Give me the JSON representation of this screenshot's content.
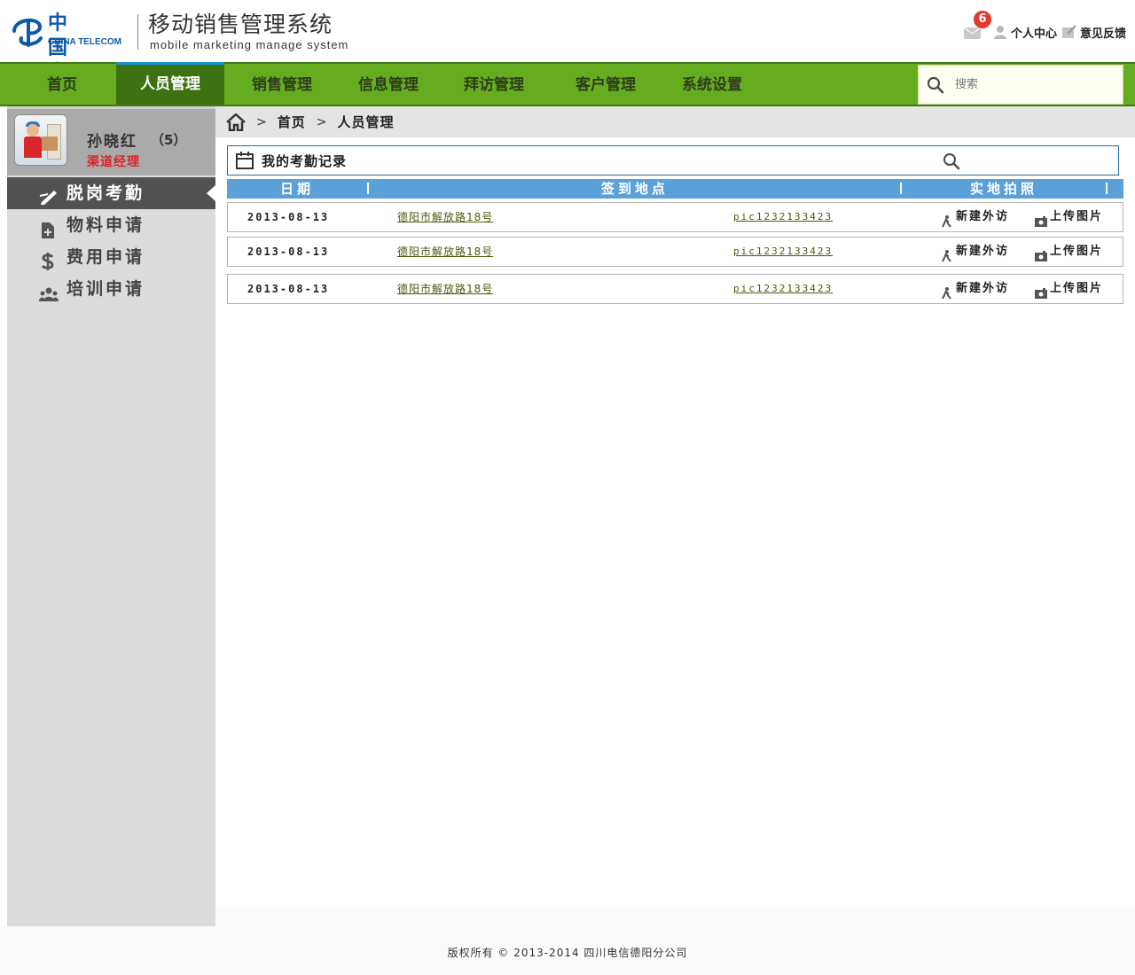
{
  "brand": {
    "logo_cn": "中国电信",
    "logo_en": "CHINA TELECOM",
    "system_title": "移动销售管理系统",
    "system_subtitle": "mobile marketing manage system"
  },
  "topbar": {
    "mail_badge": "6",
    "personal_center": "个人中心",
    "feedback": "意见反馈"
  },
  "nav": {
    "items": [
      {
        "label": "首页"
      },
      {
        "label": "人员管理"
      },
      {
        "label": "销售管理"
      },
      {
        "label": "信息管理"
      },
      {
        "label": "拜访管理"
      },
      {
        "label": "客户管理"
      },
      {
        "label": "系统设置"
      }
    ],
    "active_index": 1,
    "search_placeholder": "搜索"
  },
  "profile": {
    "name": "孙晓红",
    "count": "（5）",
    "role": "渠道经理"
  },
  "sidebar": {
    "items": [
      {
        "label": "脱岗考勤",
        "icon": "edit-icon",
        "active": true
      },
      {
        "label": "物料申请",
        "icon": "file-add-icon",
        "active": false
      },
      {
        "label": "费用申请",
        "icon": "dollar-icon",
        "active": false
      },
      {
        "label": "培训申请",
        "icon": "group-icon",
        "active": false
      }
    ]
  },
  "breadcrumb": {
    "home": "首页",
    "current": "人员管理"
  },
  "panel": {
    "title": "我的考勤记录"
  },
  "table": {
    "headers": [
      "日期",
      "签到地点",
      "实地拍照"
    ],
    "rows": [
      {
        "date": "2013-08-13",
        "address": "德阳市解放路18号",
        "photo": "pic1232133423",
        "visit": "新建外访",
        "upload": "上传图片"
      },
      {
        "date": "2013-08-13",
        "address": "德阳市解放路18号",
        "photo": "pic1232133423",
        "visit": "新建外访",
        "upload": "上传图片"
      },
      {
        "date": "2013-08-13",
        "address": "德阳市解放路18号",
        "photo": "pic1232133423",
        "visit": "新建外访",
        "upload": "上传图片"
      }
    ]
  },
  "footer": {
    "text": "版权所有 © 2013-2014 四川电信德阳分公司"
  },
  "colors": {
    "nav_bg": "#65ad1e",
    "nav_active": "#3c7212",
    "table_header": "#5ba0d6",
    "brand_blue": "#0d5aa7",
    "role_red": "#d8262b"
  }
}
